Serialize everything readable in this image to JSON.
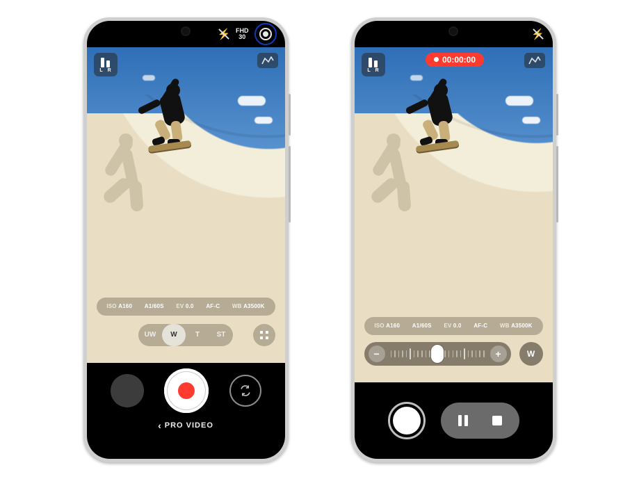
{
  "phone1": {
    "status": {
      "resolution": "FHD",
      "fps": "30"
    },
    "audio_meter": {
      "left_label": "L",
      "right_label": "R"
    },
    "params": {
      "iso_label": "ISO",
      "iso_value": "A160",
      "shutter_value": "A1/60S",
      "ev_label": "EV",
      "ev_value": "0.0",
      "af_value": "AF-C",
      "wb_label": "WB",
      "wb_value": "A3500K"
    },
    "lenses": {
      "uw": "UW",
      "w": "W",
      "t": "T",
      "st": "ST"
    },
    "mode_label": "PRO VIDEO"
  },
  "phone2": {
    "rec_time": "00:00:00",
    "audio_meter": {
      "left_label": "L",
      "right_label": "R"
    },
    "params": {
      "iso_label": "ISO",
      "iso_value": "A160",
      "shutter_value": "A1/60S",
      "ev_label": "EV",
      "ev_value": "0.0",
      "af_value": "AF-C",
      "wb_label": "WB",
      "wb_value": "A3500K"
    },
    "zoom": {
      "minus": "−",
      "plus": "+"
    },
    "lens_current": "W"
  }
}
